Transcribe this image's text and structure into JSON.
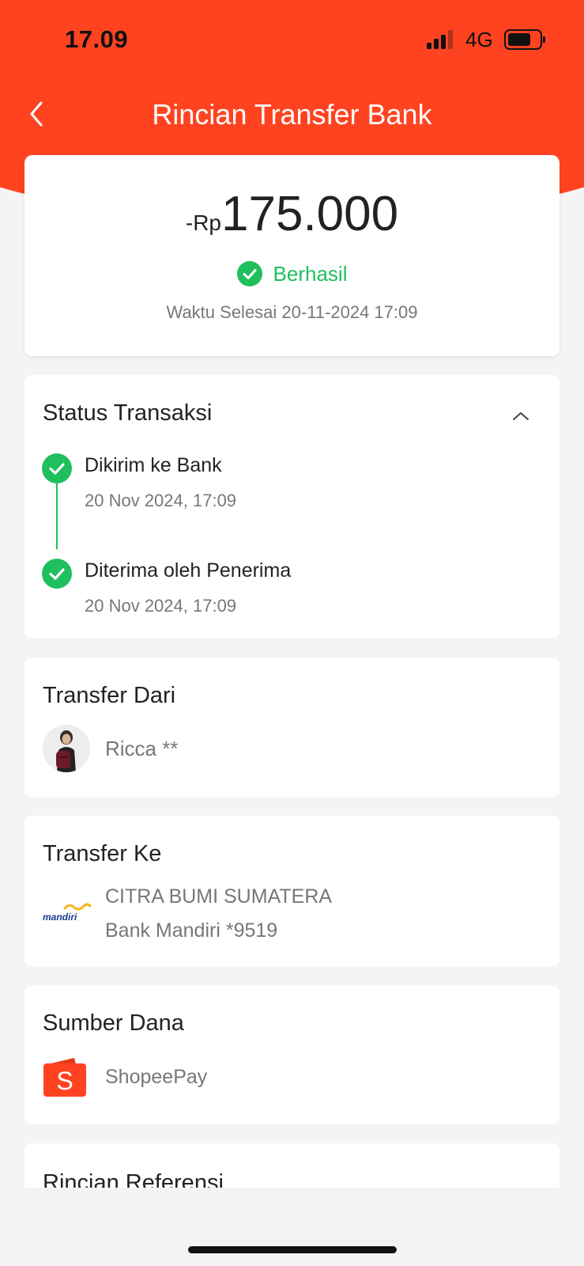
{
  "status_bar": {
    "time": "17.09",
    "network": "4G"
  },
  "header": {
    "title": "Rincian Transfer Bank"
  },
  "summary": {
    "currency_prefix": "-Rp",
    "amount": "175.000",
    "status": "Berhasil",
    "finish_time": "Waktu Selesai 20-11-2024 17:09"
  },
  "timeline": {
    "title": "Status Transaksi",
    "steps": [
      {
        "label": "Dikirim ke Bank",
        "date": "20 Nov 2024, 17:09"
      },
      {
        "label": "Diterima oleh Penerima",
        "date": "20 Nov 2024, 17:09"
      }
    ]
  },
  "transfer_from": {
    "title": "Transfer Dari",
    "name": "Ricca **"
  },
  "transfer_to": {
    "title": "Transfer Ke",
    "recipient": "CITRA BUMI SUMATERA",
    "bank_account": "Bank Mandiri *9519",
    "bank_logo_text": "mandiri"
  },
  "source": {
    "title": "Sumber Dana",
    "name": "ShopeePay"
  },
  "reference": {
    "title": "Rincian Referensi"
  },
  "colors": {
    "brand": "#ff4321",
    "success": "#1fbf5d"
  }
}
